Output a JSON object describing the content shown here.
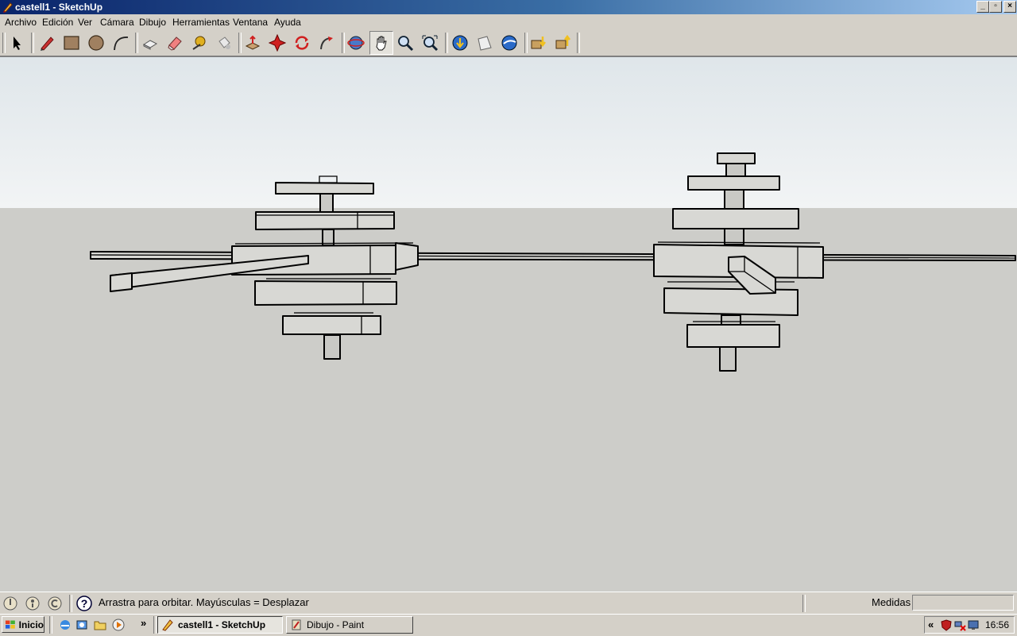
{
  "window": {
    "title": "castell1 - SketchUp",
    "min_label": "_",
    "max_label": "▫",
    "close_label": "×"
  },
  "menu": {
    "items": [
      {
        "label": "Archivo"
      },
      {
        "label": "Edición"
      },
      {
        "label": "Ver"
      },
      {
        "label": "Cámara"
      },
      {
        "label": "Dibujo"
      },
      {
        "label": "Herramientas"
      },
      {
        "label": "Ventana"
      },
      {
        "label": "Ayuda"
      }
    ]
  },
  "toolbar": {
    "tools": [
      "select-icon",
      "pencil-line-icon",
      "rectangle-icon",
      "circle-icon",
      "arc-icon",
      "make-component-icon",
      "eraser-icon",
      "tape-measure-icon",
      "paint-bucket-icon",
      "push-pull-icon",
      "move-icon",
      "rotate-icon",
      "follow-me-icon",
      "orbit-icon",
      "pan-icon",
      "zoom-icon",
      "zoom-extents-icon",
      "get-models-icon",
      "share-model-icon",
      "google-earth-icon",
      "download-icon",
      "upload-icon"
    ],
    "active_tool": "pan-icon"
  },
  "status": {
    "hint": "Arrastra para orbitar.  Mayúsculas = Desplazar",
    "measure_label": "Medidas",
    "measure_value": ""
  },
  "taskbar": {
    "start_label": "Inicio",
    "more_label": "»",
    "tasks": [
      {
        "label": "castell1 - SketchUp",
        "active": true
      },
      {
        "label": "Dibujo - Paint",
        "active": false
      }
    ],
    "tray_expand": "«",
    "clock": "16:56"
  },
  "colors": {
    "titlebar_start": "#0a246a",
    "titlebar_end": "#a6caf0",
    "chrome": "#d4d0c8",
    "sky": "#eef1f2",
    "ground": "#cdcdc9",
    "model_face": "#d8d8d4",
    "edge": "#000000"
  }
}
